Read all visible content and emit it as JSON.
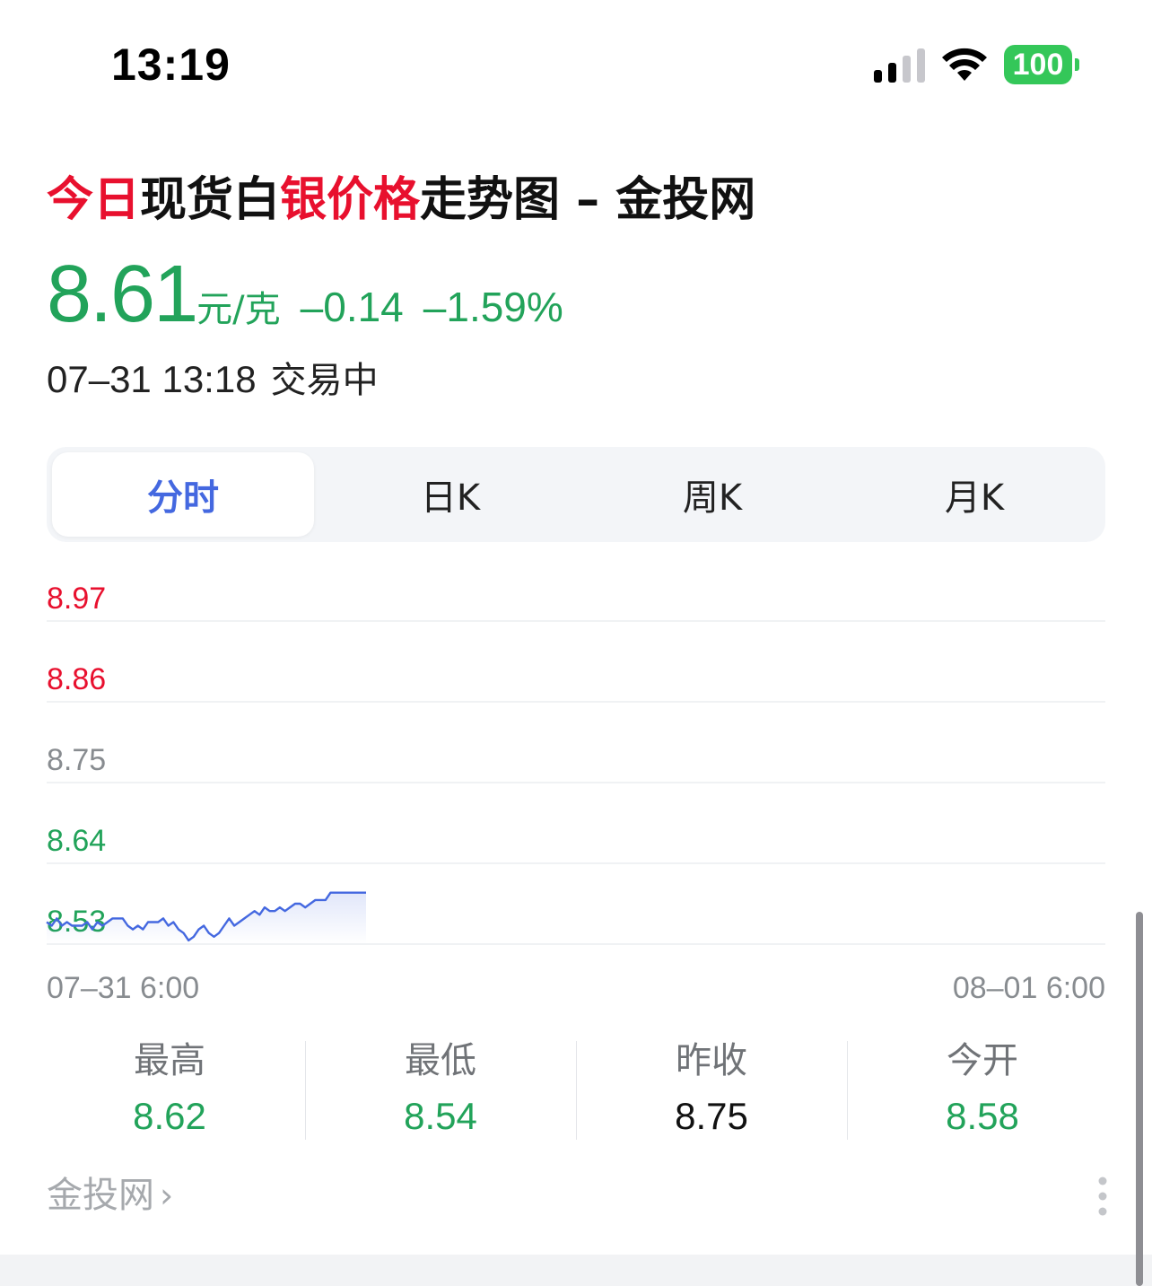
{
  "status_bar": {
    "time": "13:19",
    "battery": "100",
    "signal_icon": "cellular-signal-icon",
    "wifi_icon": "wifi-icon"
  },
  "header": {
    "title_parts": [
      {
        "text": "今日",
        "highlight": true
      },
      {
        "text": "现货白",
        "highlight": false
      },
      {
        "text": "银价格",
        "highlight": true
      },
      {
        "text": "走势图 – 金投网",
        "highlight": false
      }
    ]
  },
  "quote": {
    "price": "8.61",
    "unit": "元/克",
    "change": "–0.14",
    "change_pct": "–1.59%",
    "timestamp": "07–31 13:18",
    "status": "交易中"
  },
  "tabs": [
    {
      "label": "分时",
      "active": true
    },
    {
      "label": "日K",
      "active": false
    },
    {
      "label": "周K",
      "active": false
    },
    {
      "label": "月K",
      "active": false
    }
  ],
  "colors": {
    "up": "#e8102e",
    "down": "#22a35a",
    "neutral": "#888c90",
    "line": "#4468e0",
    "tab_active": "#4468e0"
  },
  "chart_data": {
    "type": "line",
    "ylim": [
      8.53,
      8.97
    ],
    "y_ticks": [
      {
        "label": "8.97",
        "tone": "up"
      },
      {
        "label": "8.86",
        "tone": "up"
      },
      {
        "label": "8.75",
        "tone": "neutral"
      },
      {
        "label": "8.64",
        "tone": "down"
      },
      {
        "label": "8.53",
        "tone": "down"
      }
    ],
    "x_start_label": "07–31 6:00",
    "x_end_label": "08–01 6:00",
    "series": [
      {
        "values": [
          8.56,
          8.555,
          8.565,
          8.555,
          8.56,
          8.555,
          8.555,
          8.555,
          8.56,
          8.55,
          8.56,
          8.555,
          8.56,
          8.565,
          8.565,
          8.565,
          8.555,
          8.55,
          8.555,
          8.55,
          8.56,
          8.56,
          8.56,
          8.565,
          8.555,
          8.56,
          8.55,
          8.545,
          8.535,
          8.54,
          8.55,
          8.555,
          8.545,
          8.54,
          8.545,
          8.555,
          8.565,
          8.555,
          8.56,
          8.565,
          8.57,
          8.575,
          8.57,
          8.58,
          8.575,
          8.575,
          8.58,
          8.575,
          8.58,
          8.585,
          8.585,
          8.58,
          8.585,
          8.59,
          8.59,
          8.59,
          8.6,
          8.6,
          8.6,
          8.6,
          8.6,
          8.6,
          8.6,
          8.6
        ]
      }
    ]
  },
  "stats": [
    {
      "label": "最高",
      "value": "8.62",
      "tone": "down"
    },
    {
      "label": "最低",
      "value": "8.54",
      "tone": "down"
    },
    {
      "label": "昨收",
      "value": "8.75",
      "tone": "neutral"
    },
    {
      "label": "今开",
      "value": "8.58",
      "tone": "down"
    }
  ],
  "footer": {
    "source": "金投网",
    "chevron": "›",
    "more_icon": "more-vertical-icon"
  }
}
